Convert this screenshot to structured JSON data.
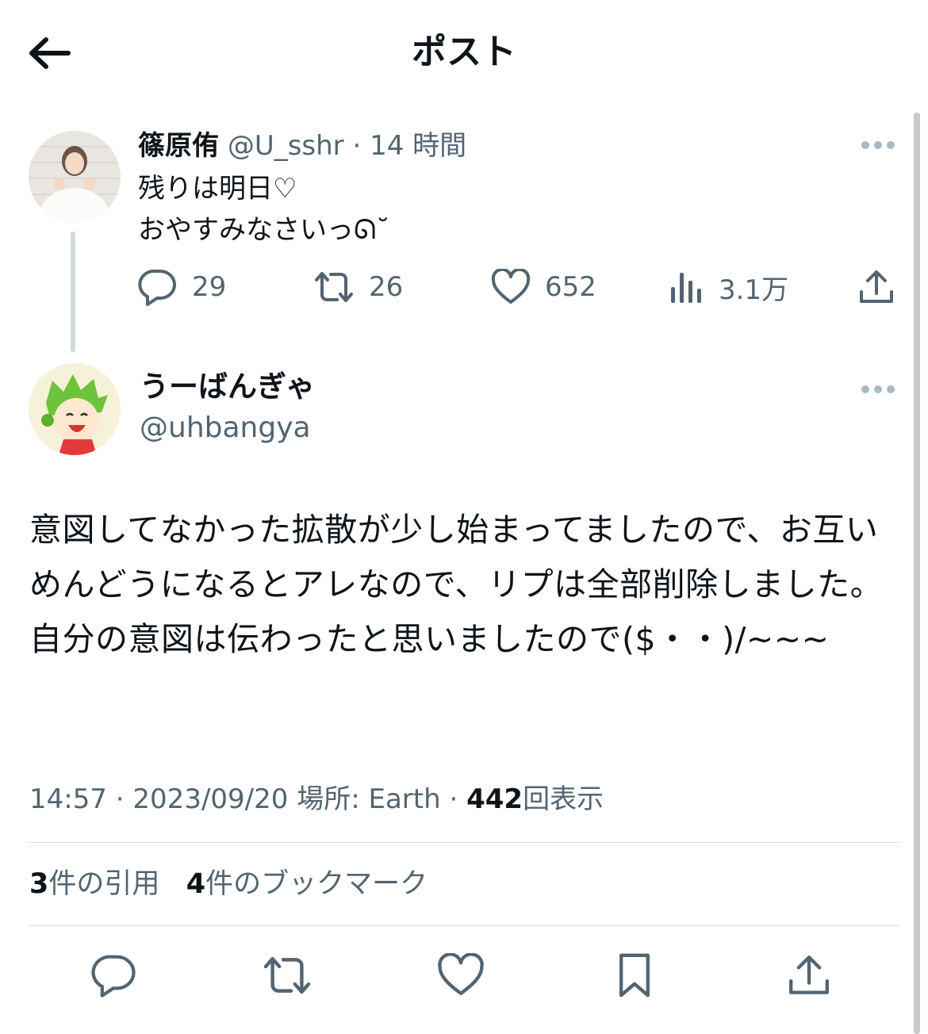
{
  "header": {
    "title": "ポスト"
  },
  "parent_post": {
    "display_name": "篠原侑",
    "handle": "@U_sshr",
    "separator": "·",
    "time": "14 時間",
    "text": "残りは明日♡\nおやすみなさいっᘏ˘",
    "counts": {
      "replies": "29",
      "reposts": "26",
      "likes": "652",
      "views": "3.1万"
    }
  },
  "post": {
    "display_name": "うーばんぎゃ",
    "handle": "@uhbangya",
    "text": "意図してなかった拡散が少し始まってましたので、お互いめんどうになるとアレなので、リプは全部削除しました。\n自分の意図は伝わったと思いましたので($・・)/~~~",
    "time": "14:57",
    "date": "2023/09/20",
    "location_label": "場所: Earth",
    "views_count": "442",
    "views_label": "回表示",
    "separator": "·",
    "quotes_count": "3",
    "quotes_label": "件の引用",
    "bookmarks_count": "4",
    "bookmarks_label": "件のブックマーク"
  },
  "colors": {
    "text": "#0f1419",
    "secondary": "#536471",
    "divider": "#d6dde1",
    "thread_line": "#cfd9de"
  },
  "icons": [
    "back-arrow-icon",
    "more-icon",
    "reply-icon",
    "repost-icon",
    "like-icon",
    "views-icon",
    "share-icon",
    "bookmark-icon"
  ]
}
